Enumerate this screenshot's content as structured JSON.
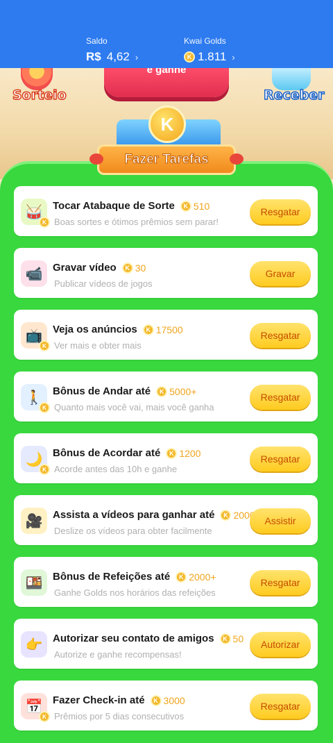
{
  "header": {
    "saldo_label": "Saldo",
    "saldo_currency": "R$",
    "saldo_value": "4,62",
    "golds_label": "Kwai Golds",
    "golds_value": "1.811",
    "chevron": "›"
  },
  "hero": {
    "left_label": "Sorteio",
    "right_label": "Receber",
    "center_partial": "e ganhe",
    "banner_title": "Fazer Tarefas",
    "coin_letter": "K"
  },
  "tasks": [
    {
      "icon": "atabaque-icon",
      "title": "Tocar Atabaque de Sorte",
      "points": "510",
      "subtitle": "Boas sortes e ótimos prêmios sem parar!",
      "button": "Resgatar"
    },
    {
      "icon": "video-camera-icon",
      "title": "Gravar vídeo",
      "points": "30",
      "subtitle": "Publicar vídeos de jogos",
      "button": "Gravar"
    },
    {
      "icon": "tv-ads-icon",
      "title": "Veja os anúncios",
      "points": "17500",
      "subtitle": "Ver mais e obter mais",
      "button": "Resgatar"
    },
    {
      "icon": "walking-person-icon",
      "title": "Bônus de Andar até",
      "points": "5000+",
      "subtitle": "Quanto mais você vai, mais você ganha",
      "button": "Resgatar"
    },
    {
      "icon": "wake-up-moon-icon",
      "title": "Bônus de Acordar até",
      "points": "1200",
      "subtitle": "Acorde antes das 10h e ganhe",
      "button": "Resgatar"
    },
    {
      "icon": "movie-camera-icon",
      "title": "Assista a vídeos para ganhar até",
      "points": "2000",
      "subtitle": "Deslize os vídeos para obter facilmente",
      "button": "Assistir"
    },
    {
      "icon": "meal-icon",
      "title": "Bônus de Refeições até",
      "points": "2000+",
      "subtitle": "Ganhe Golds nos horários das refeições",
      "button": "Resgatar"
    },
    {
      "icon": "contacts-hand-icon",
      "title": "Autorizar seu contato de amigos",
      "points": "50",
      "subtitle": "Autorize e ganhe recompensas!",
      "button": "Autorizar"
    },
    {
      "icon": "calendar-checkin-icon",
      "title": "Fazer Check-in até",
      "points": "3000",
      "subtitle": "Prêmios por 5 dias consecutivos",
      "button": "Resgatar"
    }
  ],
  "colors": {
    "header_blue": "#2e7bf0",
    "container_green": "#39d83e",
    "button_yellow": "#ffd33a",
    "points_orange": "#f0a51d"
  }
}
